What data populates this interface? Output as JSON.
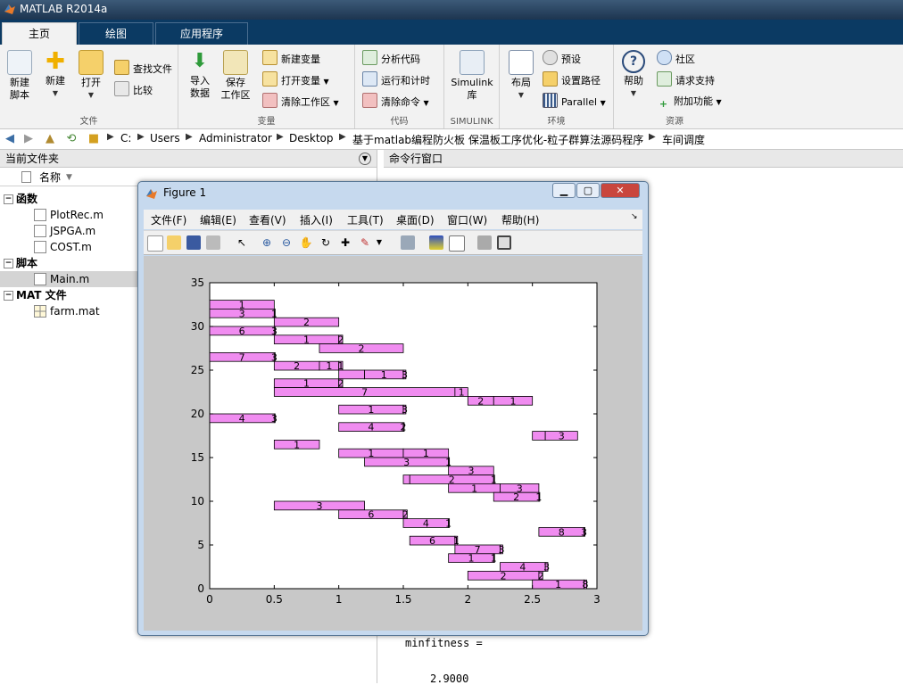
{
  "window": {
    "title": "MATLAB R2014a"
  },
  "tabs": [
    {
      "label": "主页",
      "active": true
    },
    {
      "label": "绘图",
      "active": false
    },
    {
      "label": "应用程序",
      "active": false
    }
  ],
  "ribbon": {
    "file_group": {
      "label": "文件",
      "new_script": "新建\n脚本",
      "new": "新建",
      "open": "打开",
      "find_files": "查找文件",
      "compare": "比较"
    },
    "variable_group": {
      "label": "变量",
      "import_data": "导入\n数据",
      "save_workspace": "保存\n工作区",
      "new_variable": "新建变量",
      "open_variable": "打开变量",
      "clear_workspace": "清除工作区"
    },
    "code_group": {
      "label": "代码",
      "analyze_code": "分析代码",
      "run_and_time": "运行和计时",
      "clear_commands": "清除命令"
    },
    "simulink_group": {
      "label": "SIMULINK",
      "library": "Simulink\n库"
    },
    "environment_group": {
      "label": "环境",
      "layout": "布局",
      "preferences": "预设",
      "set_path": "设置路径",
      "parallel": "Parallel"
    },
    "resources_group": {
      "label": "资源",
      "help": "帮助",
      "community": "社区",
      "request_support": "请求支持",
      "add_ons": "附加功能"
    }
  },
  "address": {
    "path": [
      "C:",
      "Users",
      "Administrator",
      "Desktop",
      "基于matlab编程防火板 保温板工序优化-粒子群算法源码程序",
      "车间调度"
    ]
  },
  "current_folder": {
    "title": "当前文件夹",
    "column_name": "名称",
    "sections": [
      {
        "label": "函数",
        "files": [
          "PlotRec.m",
          "JSPGA.m",
          "COST.m"
        ]
      },
      {
        "label": "脚本",
        "files": [
          "Main.m"
        ]
      },
      {
        "label": "MAT 文件",
        "files": [
          "farm.mat"
        ]
      }
    ]
  },
  "command_window": {
    "title": "命令行窗口",
    "lines": [
      "minfitness =",
      "2.9000"
    ]
  },
  "figure": {
    "title": "Figure 1",
    "menus": [
      "文件(F)",
      "编辑(E)",
      "查看(V)",
      "插入(I)",
      "工具(T)",
      "桌面(D)",
      "窗口(W)",
      "帮助(H)"
    ],
    "bar_color": "#f08cf0"
  },
  "chart_data": {
    "type": "bar",
    "orientation": "horizontal-gantt",
    "title": "",
    "xlabel": "",
    "ylabel": "",
    "xlim": [
      0,
      3
    ],
    "ylim": [
      0,
      35
    ],
    "xticks": [
      "0",
      "0.5",
      "1",
      "1.5",
      "2",
      "2.5",
      "3"
    ],
    "yticks": [
      "0",
      "5",
      "10",
      "15",
      "20",
      "25",
      "30",
      "35"
    ],
    "grid": false,
    "bars": [
      {
        "y": 32.5,
        "start": 0.0,
        "end": 0.5,
        "label": "1"
      },
      {
        "y": 31.5,
        "start": 0.0,
        "end": 0.5,
        "label": "3"
      },
      {
        "y": 31.5,
        "start": 0.5,
        "end": 0.5,
        "label": "1"
      },
      {
        "y": 30.5,
        "start": 0.5,
        "end": 1.0,
        "label": "2"
      },
      {
        "y": 29.5,
        "start": 0.0,
        "end": 0.5,
        "label": "6"
      },
      {
        "y": 29.5,
        "start": 0.5,
        "end": 0.5,
        "label": "3"
      },
      {
        "y": 28.5,
        "start": 0.5,
        "end": 1.0,
        "label": "1"
      },
      {
        "y": 28.5,
        "start": 1.0,
        "end": 1.03,
        "label": "2"
      },
      {
        "y": 27.5,
        "start": 0.85,
        "end": 1.5,
        "label": "2"
      },
      {
        "y": 26.5,
        "start": 0.0,
        "end": 0.5,
        "label": "7"
      },
      {
        "y": 26.5,
        "start": 0.5,
        "end": 0.5,
        "label": "3"
      },
      {
        "y": 25.5,
        "start": 0.5,
        "end": 0.85,
        "label": "2"
      },
      {
        "y": 25.5,
        "start": 0.85,
        "end": 1.0,
        "label": "1"
      },
      {
        "y": 25.5,
        "start": 1.0,
        "end": 1.03,
        "label": "1"
      },
      {
        "y": 24.5,
        "start": 1.0,
        "end": 1.2,
        "label": ""
      },
      {
        "y": 24.5,
        "start": 1.2,
        "end": 1.5,
        "label": "1"
      },
      {
        "y": 24.5,
        "start": 1.5,
        "end": 1.52,
        "label": "3"
      },
      {
        "y": 23.5,
        "start": 0.5,
        "end": 1.0,
        "label": "1"
      },
      {
        "y": 23.5,
        "start": 1.0,
        "end": 1.03,
        "label": "2"
      },
      {
        "y": 22.5,
        "start": 0.5,
        "end": 1.9,
        "label": "7"
      },
      {
        "y": 22.5,
        "start": 1.9,
        "end": 2.0,
        "label": "1"
      },
      {
        "y": 21.5,
        "start": 2.0,
        "end": 2.2,
        "label": "2"
      },
      {
        "y": 21.5,
        "start": 2.2,
        "end": 2.5,
        "label": "1"
      },
      {
        "y": 20.5,
        "start": 1.0,
        "end": 1.5,
        "label": "1"
      },
      {
        "y": 20.5,
        "start": 1.5,
        "end": 1.52,
        "label": "3"
      },
      {
        "y": 19.5,
        "start": 0.0,
        "end": 0.5,
        "label": "4"
      },
      {
        "y": 19.5,
        "start": 0.5,
        "end": 0.5,
        "label": "3"
      },
      {
        "y": 18.5,
        "start": 1.0,
        "end": 1.5,
        "label": "4"
      },
      {
        "y": 18.5,
        "start": 1.5,
        "end": 1.5,
        "label": "2"
      },
      {
        "y": 17.5,
        "start": 2.5,
        "end": 2.6,
        "label": ""
      },
      {
        "y": 17.5,
        "start": 2.6,
        "end": 2.85,
        "label": "3"
      },
      {
        "y": 16.5,
        "start": 0.5,
        "end": 0.85,
        "label": "1"
      },
      {
        "y": 15.5,
        "start": 1.0,
        "end": 1.5,
        "label": "1"
      },
      {
        "y": 15.5,
        "start": 1.5,
        "end": 1.85,
        "label": "1"
      },
      {
        "y": 14.5,
        "start": 1.2,
        "end": 1.85,
        "label": "3"
      },
      {
        "y": 14.5,
        "start": 1.85,
        "end": 1.85,
        "label": "1"
      },
      {
        "y": 13.5,
        "start": 1.85,
        "end": 2.2,
        "label": "3"
      },
      {
        "y": 12.5,
        "start": 1.5,
        "end": 1.55,
        "label": ""
      },
      {
        "y": 12.5,
        "start": 1.55,
        "end": 2.2,
        "label": "2"
      },
      {
        "y": 12.5,
        "start": 2.2,
        "end": 2.2,
        "label": "1"
      },
      {
        "y": 11.5,
        "start": 1.85,
        "end": 2.25,
        "label": "1"
      },
      {
        "y": 11.5,
        "start": 2.25,
        "end": 2.55,
        "label": "3"
      },
      {
        "y": 10.5,
        "start": 2.2,
        "end": 2.55,
        "label": "2"
      },
      {
        "y": 10.5,
        "start": 2.55,
        "end": 2.55,
        "label": "1"
      },
      {
        "y": 9.5,
        "start": 0.5,
        "end": 1.2,
        "label": "3"
      },
      {
        "y": 8.5,
        "start": 1.0,
        "end": 1.5,
        "label": "6"
      },
      {
        "y": 8.5,
        "start": 1.5,
        "end": 1.53,
        "label": "2"
      },
      {
        "y": 7.5,
        "start": 1.5,
        "end": 1.85,
        "label": "4"
      },
      {
        "y": 7.5,
        "start": 1.85,
        "end": 1.85,
        "label": "1"
      },
      {
        "y": 6.5,
        "start": 2.55,
        "end": 2.9,
        "label": "8"
      },
      {
        "y": 6.5,
        "start": 2.9,
        "end": 2.9,
        "label": "3"
      },
      {
        "y": 5.5,
        "start": 1.55,
        "end": 1.9,
        "label": "6"
      },
      {
        "y": 5.5,
        "start": 1.9,
        "end": 1.92,
        "label": "1"
      },
      {
        "y": 4.5,
        "start": 1.9,
        "end": 2.25,
        "label": "7"
      },
      {
        "y": 4.5,
        "start": 2.25,
        "end": 2.27,
        "label": "3"
      },
      {
        "y": 3.5,
        "start": 1.85,
        "end": 2.2,
        "label": "1"
      },
      {
        "y": 3.5,
        "start": 2.2,
        "end": 2.2,
        "label": "1"
      },
      {
        "y": 2.5,
        "start": 2.25,
        "end": 2.6,
        "label": "4"
      },
      {
        "y": 2.5,
        "start": 2.6,
        "end": 2.62,
        "label": "3"
      },
      {
        "y": 1.5,
        "start": 2.0,
        "end": 2.55,
        "label": "2"
      },
      {
        "y": 1.5,
        "start": 2.55,
        "end": 2.58,
        "label": "2"
      },
      {
        "y": 0.5,
        "start": 2.5,
        "end": 2.9,
        "label": "1"
      },
      {
        "y": 0.5,
        "start": 2.9,
        "end": 2.92,
        "label": "8"
      }
    ]
  }
}
